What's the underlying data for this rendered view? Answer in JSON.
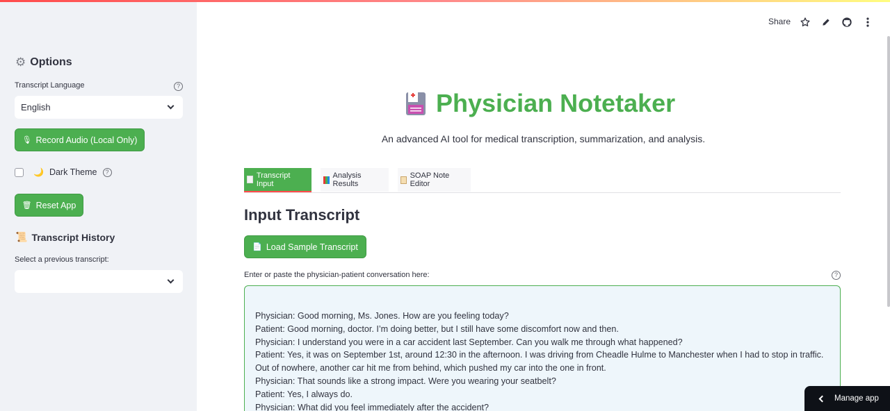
{
  "sidebar": {
    "title": "Options",
    "language_label": "Transcript Language",
    "language_value": "English",
    "record_button": "Record Audio (Local Only)",
    "dark_theme_label": "Dark Theme",
    "dark_theme_checked": false,
    "reset_button": "Reset App",
    "history_title": "Transcript History",
    "history_label": "Select a previous transcript:",
    "history_value": ""
  },
  "header": {
    "share_label": "Share",
    "icons": [
      "star-icon",
      "edit-icon",
      "github-icon",
      "more-icon"
    ]
  },
  "main": {
    "app_title": "Physician Notetaker",
    "subtitle": "An advanced AI tool for medical transcription, summarization, and analysis.",
    "tabs": [
      {
        "label": "Transcript Input",
        "active": true
      },
      {
        "label": "Analysis Results",
        "active": false
      },
      {
        "label": "SOAP Note Editor",
        "active": false
      }
    ],
    "section_heading": "Input Transcript",
    "load_sample_button": "Load Sample Transcript",
    "textarea_label": "Enter or paste the physician-patient conversation here:",
    "transcript": "Physician: Good morning, Ms. Jones. How are you feeling today?\nPatient: Good morning, doctor. I’m doing better, but I still have some discomfort now and then.\nPhysician: I understand you were in a car accident last September. Can you walk me through what happened?\nPatient: Yes, it was on September 1st, around 12:30 in the afternoon. I was driving from Cheadle Hulme to Manchester when I had to stop in traffic. Out of nowhere, another car hit me from behind, which pushed my car into the one in front.\nPhysician: That sounds like a strong impact. Were you wearing your seatbelt?\nPatient: Yes, I always do.\nPhysician: What did you feel immediately after the accident?"
  },
  "manage_app_label": "Manage app",
  "colors": {
    "accent_green": "#4caf50",
    "accent_red": "#ff4b4b",
    "sidebar_bg": "#f0f2f6",
    "textarea_bg": "#eef6fb"
  }
}
